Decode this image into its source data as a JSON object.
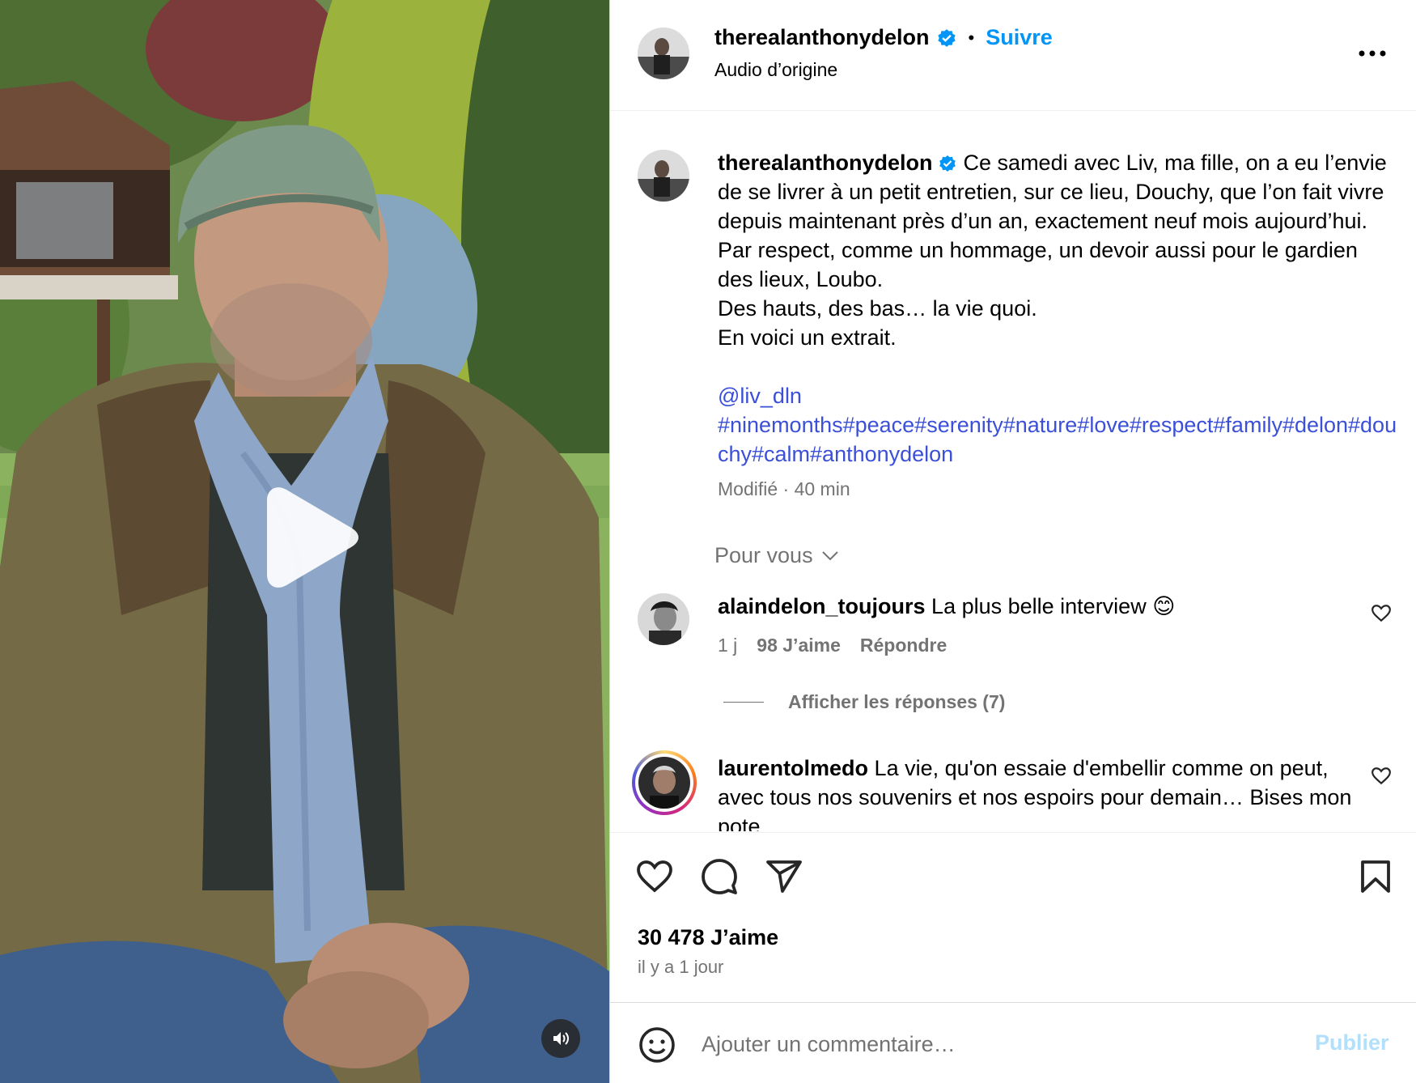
{
  "post": {
    "username": "therealanthonydelon",
    "follow_label": "Suivre",
    "dot": "•",
    "audio": "Audio d’origine",
    "caption_lines": [
      "Ce samedi avec Liv, ma fille, on a eu l’envie de se livrer à un petit entretien, sur ce lieu, Douchy, que l’on fait vivre depuis maintenant près d’un an, exactement neuf mois aujourd’hui. Par respect, comme un hommage, un devoir aussi pour le gardien des lieux, Loubo.",
      "Des hauts, des bas… la vie quoi.",
      "En voici un extrait."
    ],
    "mention": "@liv_dln",
    "hashtags": "#ninemonths#peace#serenity#nature#love#respect#family#delon#douchy#calm#anthonydelon",
    "edited_meta": "Modifié · 40 min",
    "for_you": "Pour vous"
  },
  "comments": [
    {
      "username": "alaindelon_toujours",
      "text": "La plus belle interview 😊",
      "age": "1 j",
      "likes": "98 J’aime",
      "reply": "Répondre",
      "view_replies": "Afficher les réponses (7)"
    },
    {
      "username": "laurentolmedo",
      "text": "La vie, qu'on essaie d'embellir comme on peut, avec tous nos souvenirs et nos espoirs pour demain… Bises mon pote"
    }
  ],
  "footer": {
    "likes": "30 478 J’aime",
    "time": "il y a 1 jour",
    "input_placeholder": "Ajouter un commentaire…",
    "publish": "Publier"
  },
  "colors": {
    "link_blue": "#0095f6",
    "hashtag_blue": "#3b4fd8",
    "secondary_text": "#737373",
    "publish_disabled": "#b2dffc"
  }
}
